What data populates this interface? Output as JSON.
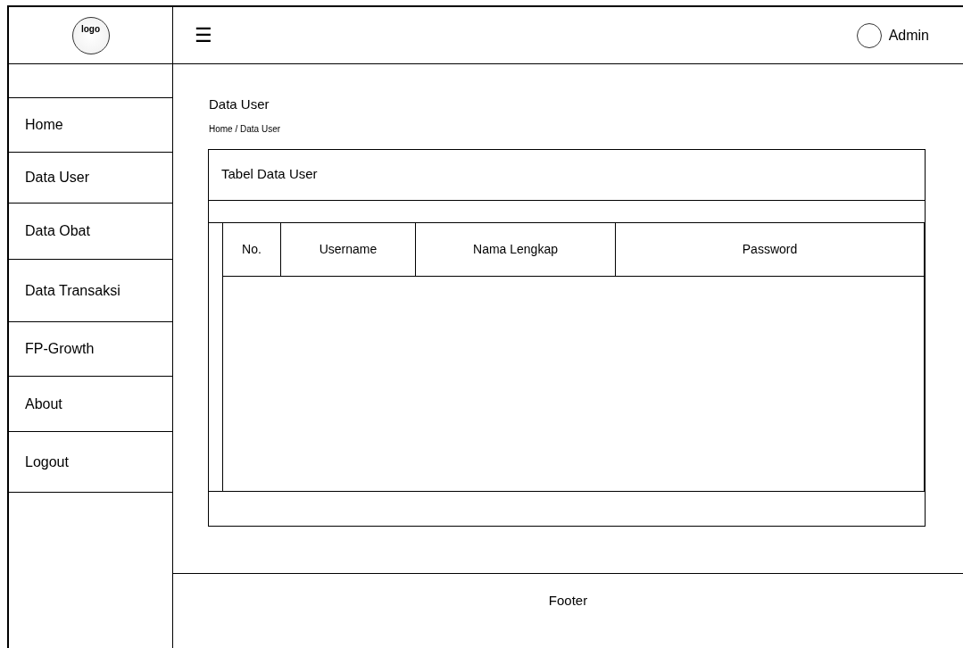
{
  "logo": {
    "text": "logo"
  },
  "header": {
    "menu_icon": "☰",
    "user": "Admin"
  },
  "sidebar": {
    "items": [
      {
        "label": "Home"
      },
      {
        "label": "Data User"
      },
      {
        "label": "Data Obat"
      },
      {
        "label": "Data Transaksi"
      },
      {
        "label": "FP-Growth"
      },
      {
        "label": "About"
      },
      {
        "label": "Logout"
      }
    ]
  },
  "page": {
    "title": "Data User",
    "breadcrumb": "Home / Data User"
  },
  "card": {
    "title": "Tabel Data User",
    "table": {
      "columns": [
        "No.",
        "Username",
        "Nama Lengkap",
        "Password"
      ]
    }
  },
  "footer": "Footer"
}
